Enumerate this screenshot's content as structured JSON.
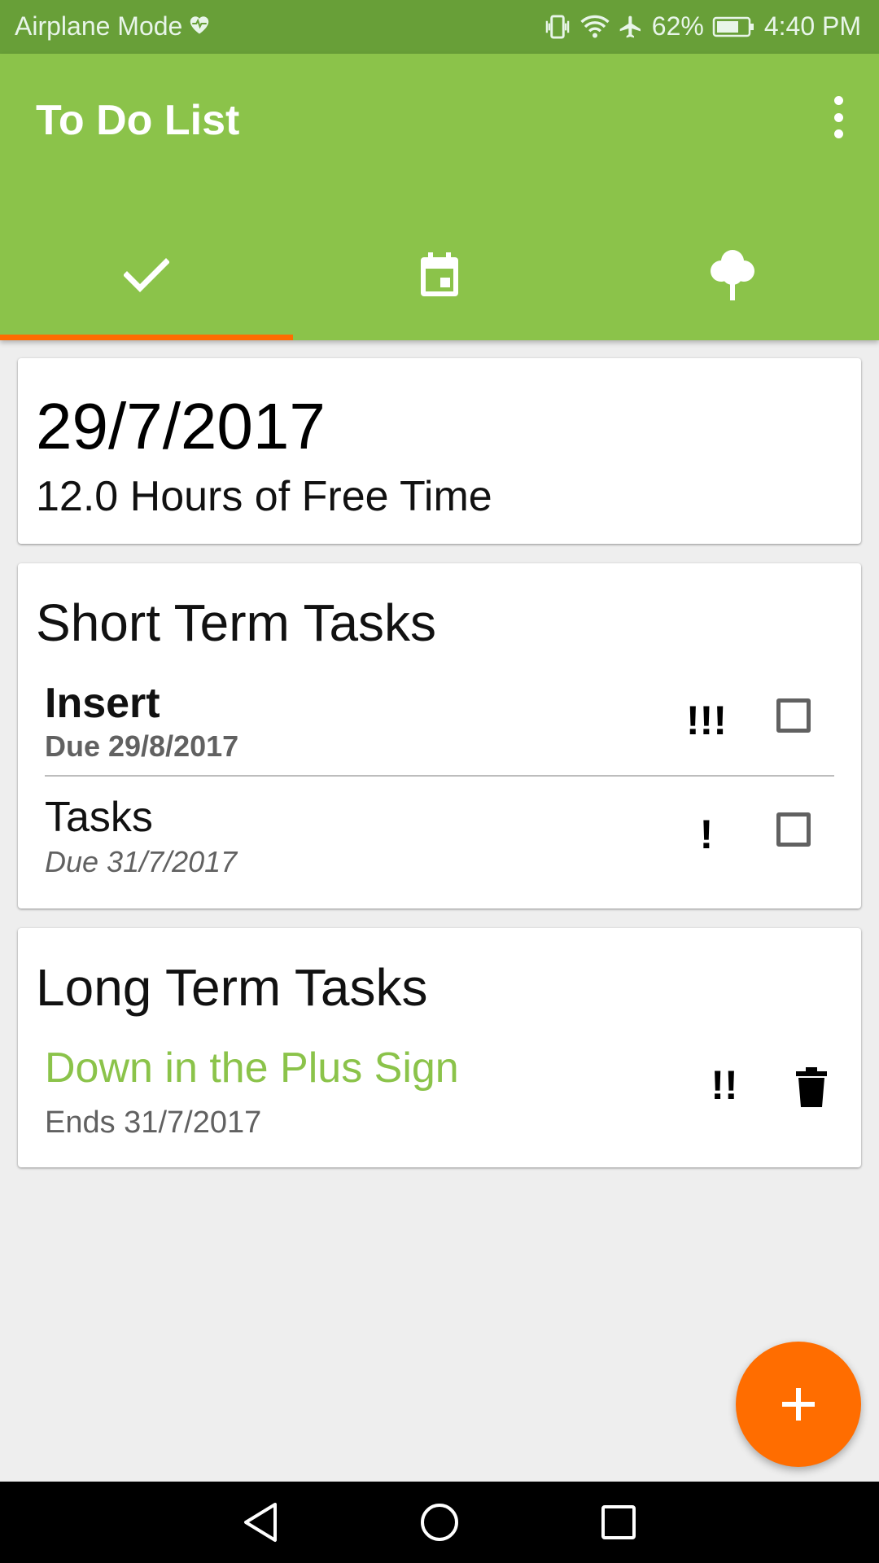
{
  "status_bar": {
    "left_text": "Airplane Mode",
    "battery_percent": "62%",
    "time": "4:40 PM",
    "icons": [
      "heart-icon",
      "vibrate-icon",
      "wifi-icon",
      "airplane-icon",
      "battery-icon"
    ]
  },
  "app_bar": {
    "title": "To Do List",
    "menu_icon": "more-vert-icon",
    "tabs": [
      {
        "icon": "check-icon",
        "selected": true
      },
      {
        "icon": "calendar-icon",
        "selected": false
      },
      {
        "icon": "tree-icon",
        "selected": false
      }
    ]
  },
  "date_card": {
    "date": "29/7/2017",
    "free_time": "12.0 Hours of Free Time"
  },
  "short_term": {
    "title": "Short Term Tasks",
    "tasks": [
      {
        "name": "Insert",
        "due": "Due 29/8/2017",
        "priority": "!!!",
        "checked": false
      },
      {
        "name": "Tasks",
        "due": "Due 31/7/2017",
        "priority": "!",
        "checked": false
      }
    ]
  },
  "long_term": {
    "title": "Long Term Tasks",
    "tasks": [
      {
        "name": "Down in the Plus Sign",
        "ends": "Ends 31/7/2017",
        "priority": "!!",
        "action_icon": "delete-icon"
      }
    ]
  },
  "fab": {
    "icon": "add-icon"
  },
  "nav_bar": {
    "icons": [
      "back-icon",
      "home-icon",
      "recents-icon"
    ]
  },
  "colors": {
    "status_bar": "#689F38",
    "primary": "#8BC34A",
    "accent": "#FF6D00",
    "background": "#EEEEEE"
  }
}
